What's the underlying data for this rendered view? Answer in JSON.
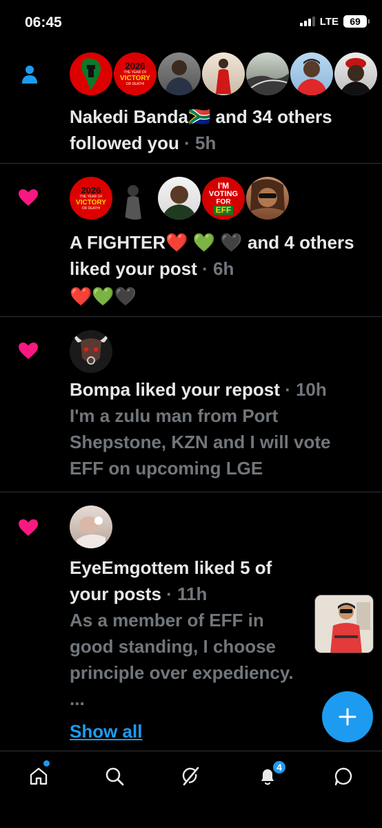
{
  "status": {
    "time": "06:45",
    "network": "LTE",
    "battery": "69"
  },
  "notifications": [
    {
      "type": "follow",
      "icon": "person-icon",
      "actor": "Nakedi Banda🇿🇦",
      "text_rest": " and 34 others followed you",
      "time": " · 5h",
      "avatar_count": 8
    },
    {
      "type": "like",
      "icon": "heart-icon",
      "actor": "A FIGHTER❤️ 💚 🖤",
      "text_rest": " and 4 others liked your post",
      "time": " · 6h",
      "content": "❤️💚🖤",
      "avatar_count": 5
    },
    {
      "type": "like",
      "icon": "heart-icon",
      "actor": "Bompa",
      "text_rest": " liked your repost",
      "time": " · 10h",
      "content": "I'm a zulu man from Port Shepstone, KZN and I will vote EFF on upcoming LGE",
      "avatar_count": 1
    },
    {
      "type": "like",
      "icon": "heart-icon",
      "actor": "EyeEmgottem",
      "text_rest": " liked 5 of your posts",
      "time": " · 11h",
      "content": "As a member of EFF in good standing, I choose principle over expediency. ...",
      "show_all": "Show all",
      "avatar_count": 1
    }
  ],
  "avatar_texts": {
    "victory_top": "2026",
    "victory_mid": "THE YEAR OF",
    "victory_main": "VICTORY",
    "victory_bottom": "OR DEATH!",
    "voting_1": "I'M",
    "voting_2": "VOTING",
    "voting_3": "FOR",
    "voting_4": "EFF"
  },
  "tabbar": {
    "items": [
      "home-icon",
      "search-icon",
      "grok-icon",
      "notifications-icon",
      "messages-icon"
    ],
    "notification_badge": "4"
  },
  "colors": {
    "accent": "#1d9bf0",
    "like": "#f91880",
    "muted": "#71767b",
    "divider": "#2f3336",
    "eff_red": "#d40000"
  }
}
